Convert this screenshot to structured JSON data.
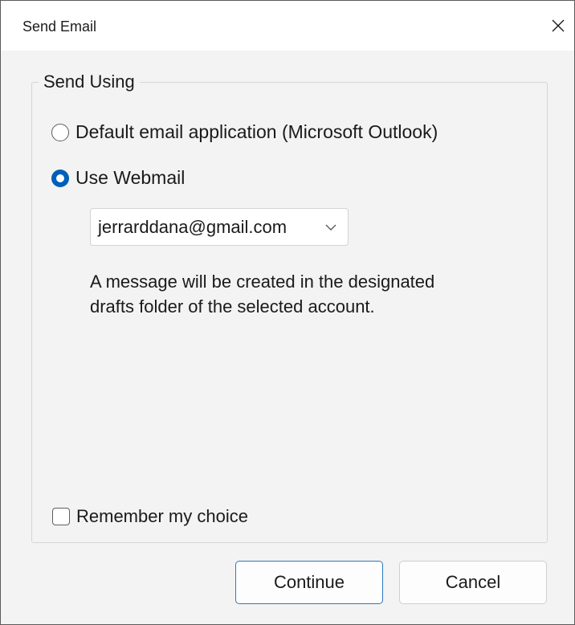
{
  "window": {
    "title": "Send Email",
    "close_icon": "close-icon"
  },
  "send_using": {
    "legend": "Send Using",
    "options": [
      {
        "label": "Default email application (Microsoft Outlook)",
        "selected": false
      },
      {
        "label": "Use Webmail",
        "selected": true
      }
    ],
    "account_select": {
      "value": "jerrarddana@gmail.com",
      "icon": "chevron-down-icon"
    },
    "info_text": "A message will be created in the designated drafts folder of the selected account.",
    "remember_label": "Remember my choice",
    "remember_checked": false
  },
  "buttons": {
    "continue_label": "Continue",
    "cancel_label": "Cancel"
  },
  "colors": {
    "accent": "#005fb8",
    "primary_border": "#2b79c2",
    "background": "#f3f3f3"
  }
}
